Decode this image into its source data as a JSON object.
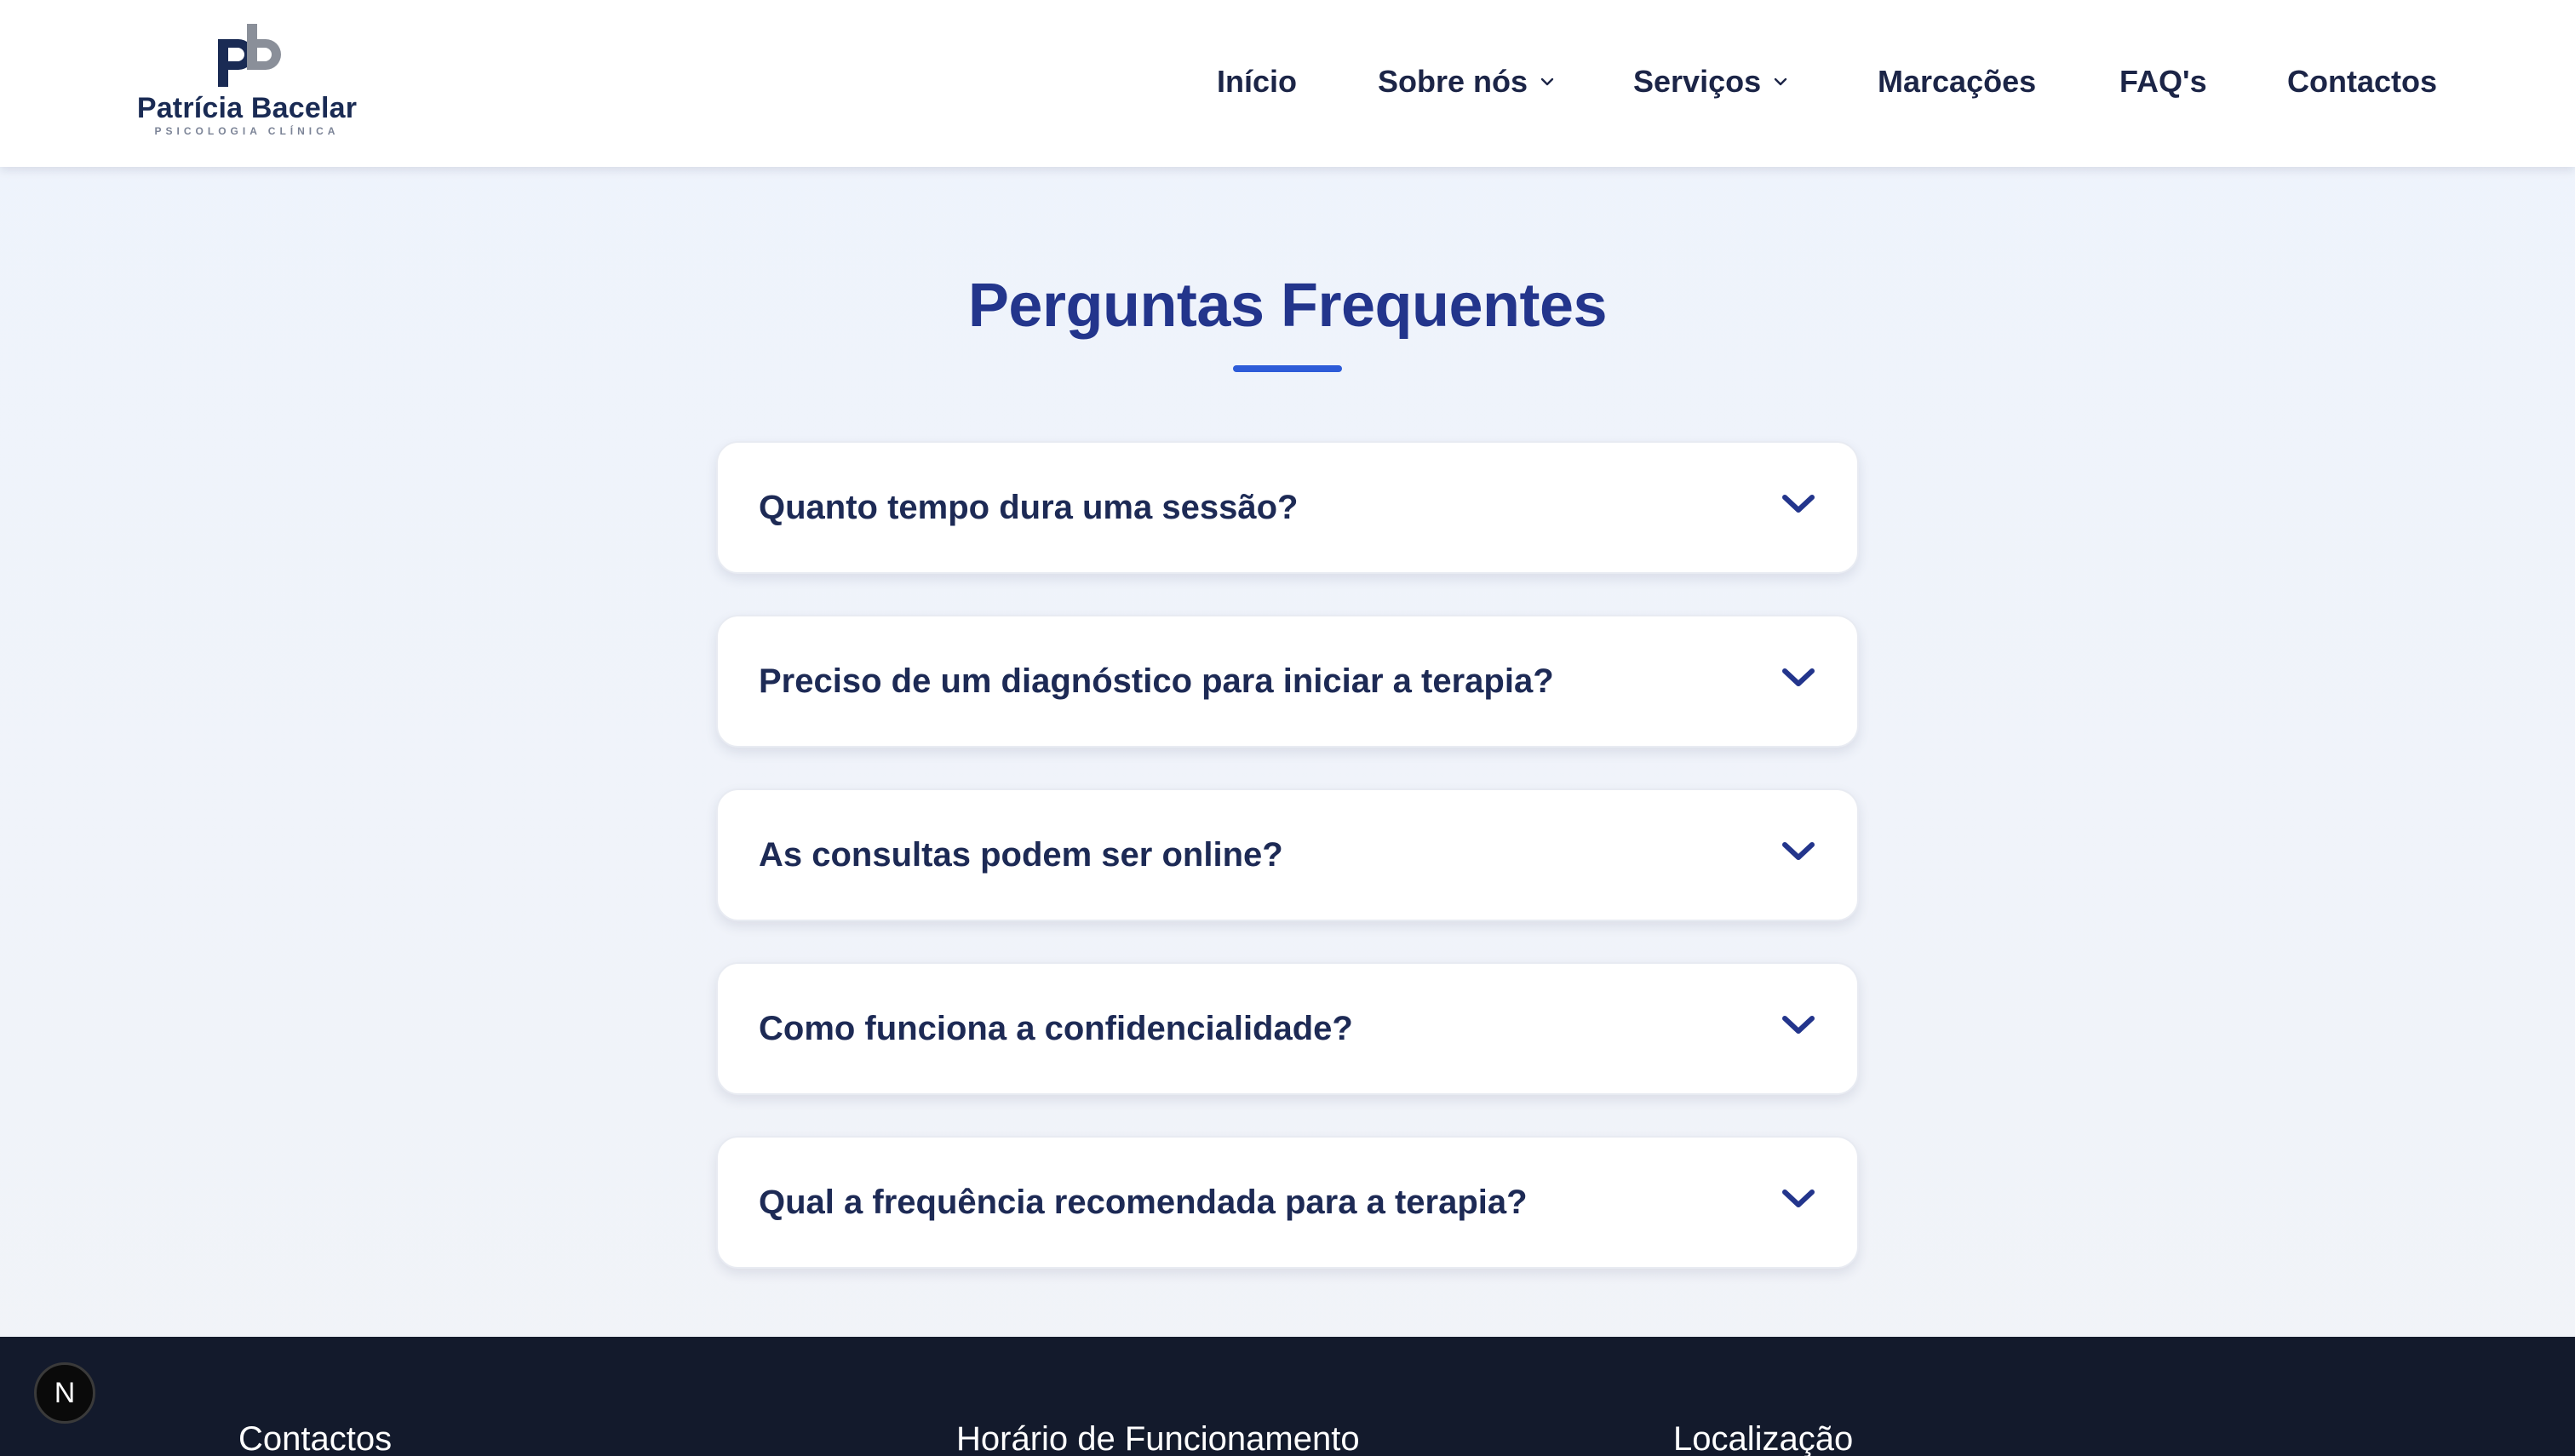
{
  "brand": {
    "name": "Patrícia Bacelar",
    "tagline": "PSICOLOGIA CLÍNICA",
    "colors": {
      "primary": "#23358c",
      "navy": "#1a2b54",
      "accent": "#2d5bd8",
      "grey": "#8a8f99"
    }
  },
  "nav": {
    "items": [
      {
        "label": "Início",
        "has_dropdown": false
      },
      {
        "label": "Sobre nós",
        "has_dropdown": true
      },
      {
        "label": "Serviços",
        "has_dropdown": true
      },
      {
        "label": "Marcações",
        "has_dropdown": false
      },
      {
        "label": "FAQ's",
        "has_dropdown": false
      },
      {
        "label": "Contactos",
        "has_dropdown": false
      }
    ]
  },
  "main": {
    "title": "Perguntas Frequentes",
    "faqs": [
      {
        "question": "Quanto tempo dura uma sessão?",
        "expanded": false
      },
      {
        "question": "Preciso de um diagnóstico para iniciar a terapia?",
        "expanded": false
      },
      {
        "question": "As consultas podem ser online?",
        "expanded": false
      },
      {
        "question": "Como funciona a confidencialidade?",
        "expanded": false
      },
      {
        "question": "Qual a frequência recomendada para a terapia?",
        "expanded": false
      }
    ]
  },
  "footer": {
    "headings": [
      "Contactos",
      "Horário de Funcionamento",
      "Localização"
    ]
  },
  "badge": {
    "letter": "N"
  },
  "icons": {
    "nav_dropdown": "chevron-down-icon",
    "faq_toggle": "chevron-down-icon"
  }
}
